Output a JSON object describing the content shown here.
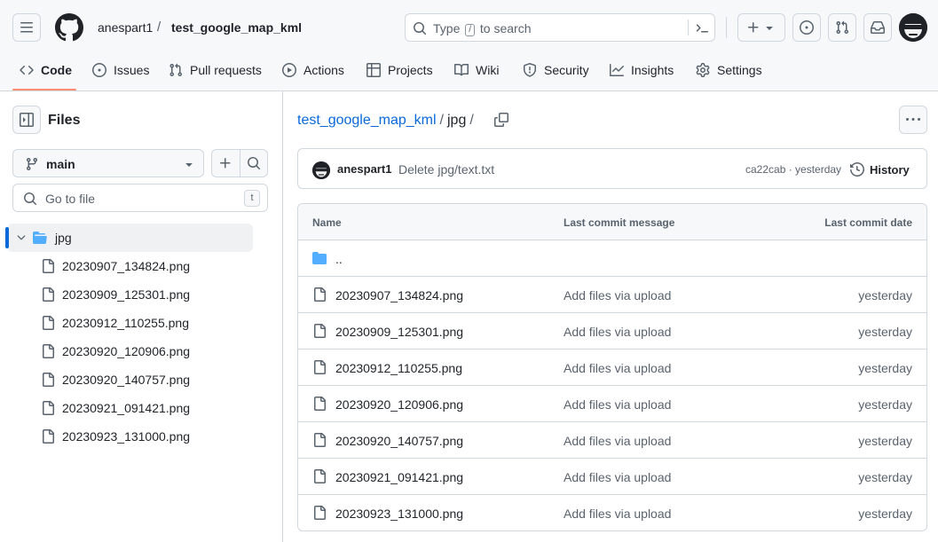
{
  "header": {
    "owner": "anespart1",
    "separator": "/",
    "repo": "test_google_map_kml",
    "search": {
      "before": "Type",
      "key": "/",
      "after": "to search"
    }
  },
  "tabs": [
    {
      "label": "Code",
      "icon": "code-icon"
    },
    {
      "label": "Issues",
      "icon": "issue-opened-icon"
    },
    {
      "label": "Pull requests",
      "icon": "git-pull-request-icon"
    },
    {
      "label": "Actions",
      "icon": "play-icon"
    },
    {
      "label": "Projects",
      "icon": "table-icon"
    },
    {
      "label": "Wiki",
      "icon": "book-icon"
    },
    {
      "label": "Security",
      "icon": "shield-icon"
    },
    {
      "label": "Insights",
      "icon": "graph-icon"
    },
    {
      "label": "Settings",
      "icon": "gear-icon"
    }
  ],
  "sidebar": {
    "title": "Files",
    "branch": "main",
    "goto_placeholder": "Go to file",
    "goto_key": "t",
    "folder": "jpg",
    "files": [
      "20230907_134824.png",
      "20230909_125301.png",
      "20230912_110255.png",
      "20230920_120906.png",
      "20230920_140757.png",
      "20230921_091421.png",
      "20230923_131000.png"
    ]
  },
  "main": {
    "breadcrumb": {
      "repo": "test_google_map_kml",
      "sep1": "/",
      "folder": "jpg",
      "sep2": "/"
    },
    "commit": {
      "author": "anespart1",
      "message": "Delete jpg/text.txt",
      "sha_time": "ca22cab · yesterday",
      "history_label": "History"
    },
    "table": {
      "headers": {
        "name": "Name",
        "message": "Last commit message",
        "date": "Last commit date"
      },
      "parent": "..",
      "rows": [
        {
          "name": "20230907_134824.png",
          "message": "Add files via upload",
          "date": "yesterday"
        },
        {
          "name": "20230909_125301.png",
          "message": "Add files via upload",
          "date": "yesterday"
        },
        {
          "name": "20230912_110255.png",
          "message": "Add files via upload",
          "date": "yesterday"
        },
        {
          "name": "20230920_120906.png",
          "message": "Add files via upload",
          "date": "yesterday"
        },
        {
          "name": "20230920_140757.png",
          "message": "Add files via upload",
          "date": "yesterday"
        },
        {
          "name": "20230921_091421.png",
          "message": "Add files via upload",
          "date": "yesterday"
        },
        {
          "name": "20230923_131000.png",
          "message": "Add files via upload",
          "date": "yesterday"
        }
      ]
    }
  },
  "colors": {
    "accent": "#0969da",
    "tab_underline": "#fd8c73",
    "folder": "#54aeff",
    "border": "#d0d7de"
  }
}
